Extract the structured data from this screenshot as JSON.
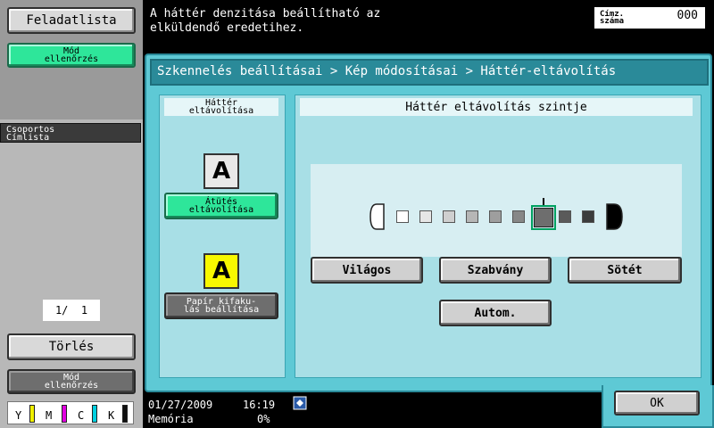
{
  "sidebar": {
    "job_list": "Feladatlista",
    "check_mode_top": "Mód\nellenőrzés",
    "group_address_list": "Csoportos\nCímlista",
    "pager": "1/  1",
    "delete": "Törlés",
    "check_mode_bottom": "Mód\nellenőrzés"
  },
  "message": "A háttér denzitása beállítható az elküldendő eredetihez.",
  "destination": {
    "label": "Címz.\nszáma",
    "count": "000"
  },
  "breadcrumb": "Szkennelés beállításai > Kép módosításai > Háttér-eltávolítás",
  "left_box": {
    "title": "Háttér\neltávolítása",
    "option1": "Átütés\neltávolítása",
    "option2": "Papír kifaku-\nlás beállítása",
    "icon_letter": "A"
  },
  "right_box": {
    "title": "Háttér eltávolítás szintje",
    "level_selected": 7,
    "level_count": 9,
    "buttons": {
      "light": "Világos",
      "standard": "Szabvány",
      "dark": "Sötét",
      "auto": "Autom."
    }
  },
  "ok": "OK",
  "status": {
    "date": "01/27/2009",
    "time": "16:19",
    "memory_label": "Memória",
    "memory_value": "0%"
  },
  "toner": [
    {
      "label": "Y",
      "color": "#f0f000"
    },
    {
      "label": "M",
      "color": "#e000e0"
    },
    {
      "label": "C",
      "color": "#00d0e0"
    },
    {
      "label": "K",
      "color": "#101010"
    }
  ],
  "colors": {
    "accent": "#5ec9d5",
    "active_green": "#2ee69a"
  }
}
